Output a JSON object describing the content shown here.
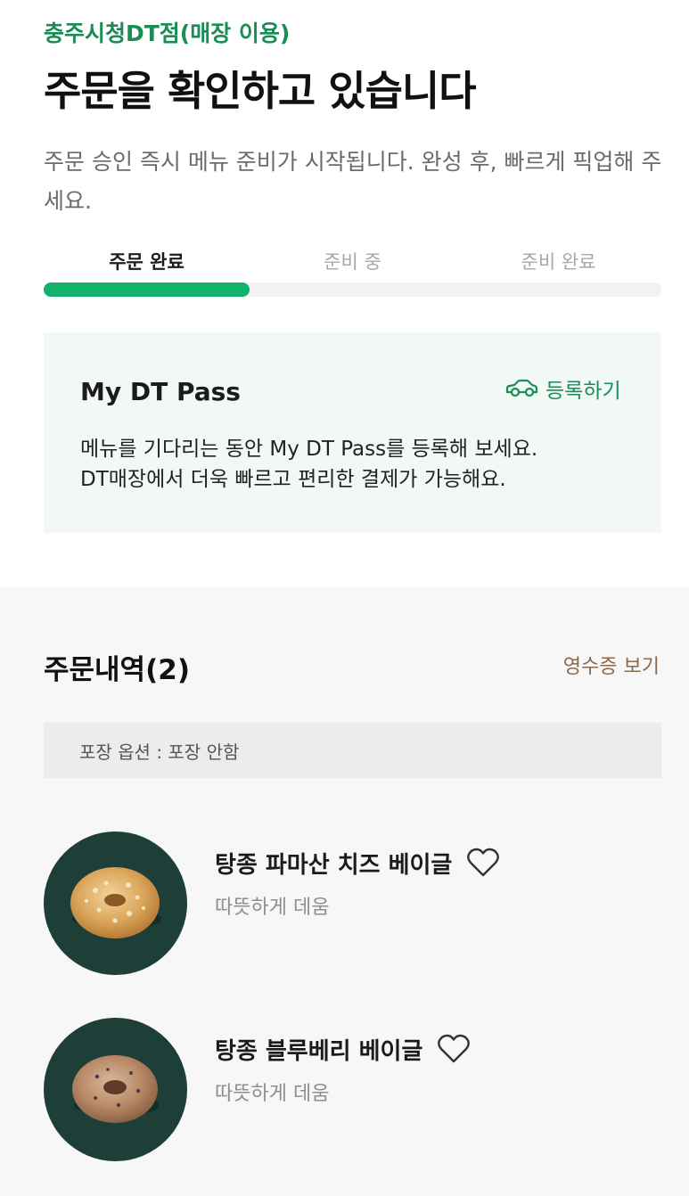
{
  "header": {
    "store_name": "충주시청DT점(매장 이용)",
    "title": "주문을 확인하고 있습니다",
    "description": "주문 승인 즉시 메뉴 준비가 시작됩니다. 완성 후, 빠르게 픽업해 주세요."
  },
  "progress": {
    "steps": [
      "주문 완료",
      "준비 중",
      "준비 완료"
    ],
    "current_step": 1,
    "fill_fraction": 0.333,
    "fill_color": "#11b36b"
  },
  "dt_pass": {
    "title": "My DT Pass",
    "register_label": "등록하기",
    "register_icon": "car-icon",
    "line1": "메뉴를 기다리는 동안 My DT Pass를 등록해 보세요.",
    "line2": "DT매장에서 더욱 빠르고 편리한 결제가 가능해요."
  },
  "orders": {
    "title": "주문내역(2)",
    "receipt_label": "영수증 보기",
    "pack_option": "포장 옵션 : 포장 안함",
    "items": [
      {
        "name": "탕종 파마산 치즈 베이글",
        "option": "따뜻하게 데움",
        "image": "parmesan-bagel-image",
        "icon": "heart-icon"
      },
      {
        "name": "탕종 블루베리 베이글",
        "option": "따뜻하게 데움",
        "image": "blueberry-bagel-image",
        "icon": "heart-icon"
      }
    ]
  },
  "colors": {
    "accent_green": "#1a8d57",
    "progress_green": "#11b36b",
    "thumb_background": "#1d3f38",
    "receipt_brown": "#8a6a4a"
  }
}
